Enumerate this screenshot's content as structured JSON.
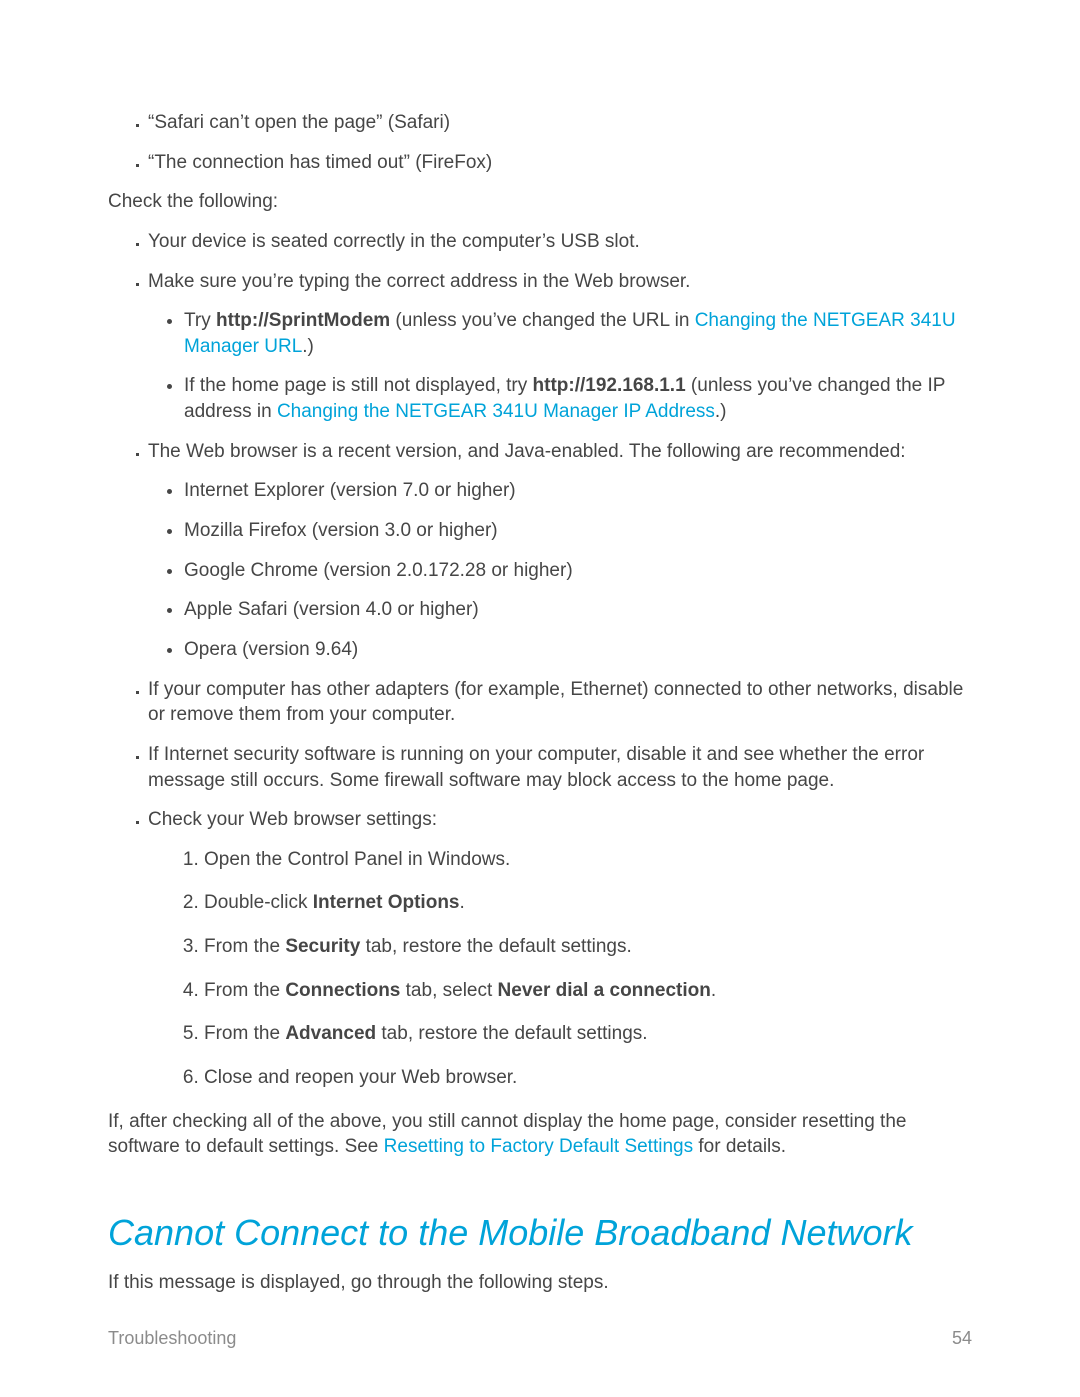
{
  "errorMessages": [
    "“Safari can’t open the page” (Safari)",
    "“The connection has timed out” (FireFox)"
  ],
  "checkIntro": "Check the following:",
  "check1": "Your device is seated correctly in the computer’s USB slot.",
  "check2": "Make sure you’re typing the correct address in the Web browser.",
  "check2a_pre": "Try ",
  "check2a_bold": "http://SprintModem",
  "check2a_mid": " (unless you’ve changed the URL in ",
  "check2a_link": "Changing the NETGEAR 341U Manager URL",
  "check2a_post": ".)",
  "check2b_pre": "If the home page is still not displayed, try ",
  "check2b_bold": "http://192.168.1.1",
  "check2b_mid": " (unless you’ve changed the IP address in ",
  "check2b_link": "Changing the NETGEAR 341U Manager IP Address",
  "check2b_post": ".)",
  "check3": "The Web browser is a recent version, and Java-enabled. The following are recommended:",
  "browsers": [
    "Internet Explorer (version 7.0 or higher)",
    "Mozilla Firefox (version 3.0 or higher)",
    "Google Chrome (version 2.0.172.28 or higher)",
    "Apple Safari (version 4.0 or higher)",
    "Opera (version 9.64)"
  ],
  "check4": "If your computer has other adapters (for example, Ethernet) connected to other networks, disable or remove them from your computer.",
  "check5": "If Internet security software is running on your computer, disable it and see whether the error message still occurs. Some firewall software may block access to the home page.",
  "check6": "Check your Web browser settings:",
  "step1": "Open the Control Panel in Windows.",
  "step2_pre": "Double-click ",
  "step2_bold": "Internet Options",
  "step2_post": ".",
  "step3_pre": "From the ",
  "step3_bold": "Security",
  "step3_post": " tab, restore the default settings.",
  "step4_pre": "From the ",
  "step4_bold1": "Connections",
  "step4_mid": " tab, select ",
  "step4_bold2": "Never dial a connection",
  "step4_post": ".",
  "step5_pre": "From the ",
  "step5_bold": "Advanced",
  "step5_post": " tab, restore the default settings.",
  "step6": "Close and reopen your Web browser.",
  "finalPara_pre": "If, after checking all of the above, you still cannot display the home page, consider resetting the software to default settings. See ",
  "finalPara_link": "Resetting to Factory Default Settings",
  "finalPara_post": " for details.",
  "sectionHeading": "Cannot Connect to the Mobile Broadband Network",
  "sectionIntro": "If this message is displayed, go through the following steps.",
  "footerLeft": "Troubleshooting",
  "footerRight": "54"
}
